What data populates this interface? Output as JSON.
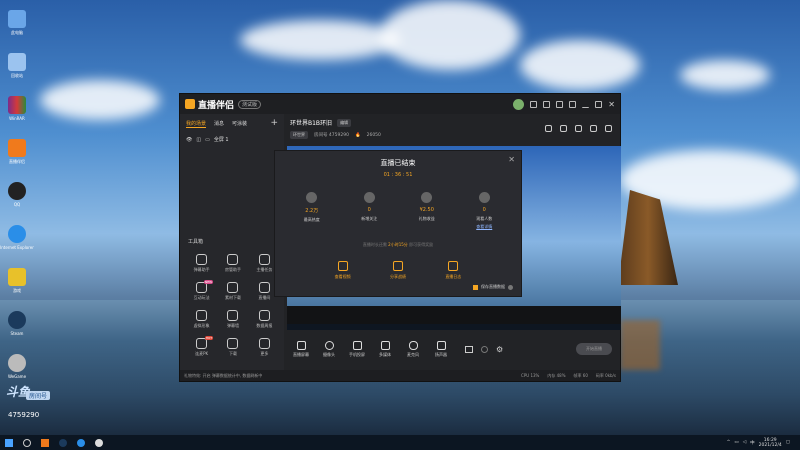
{
  "desktop": {
    "icons": [
      {
        "name": "pc-icon",
        "label": "此电脑"
      },
      {
        "name": "recycle-bin-icon",
        "label": "回收站"
      },
      {
        "name": "winrar-icon",
        "label": "WinRAR"
      },
      {
        "name": "app-orange-icon",
        "label": "直播伴侣"
      },
      {
        "name": "qq-icon",
        "label": "QQ"
      },
      {
        "name": "ie-icon",
        "label": "Internet Explorer"
      },
      {
        "name": "game-icon",
        "label": "游戏"
      },
      {
        "name": "steam-icon",
        "label": "Steam"
      },
      {
        "name": "wegame-icon",
        "label": "WeGame"
      }
    ],
    "watermark": "斗鱼",
    "room_tag": "房间号",
    "room_id": "4759290"
  },
  "window": {
    "app_title": "直播伴侣",
    "version": "测试版",
    "left_tabs": [
      "我的场景",
      "消息",
      "可涂装"
    ],
    "scene_item": "全屏 1",
    "tools_title": "工具箱",
    "tools": [
      {
        "label": "弹幕助手",
        "icon": "chat-icon",
        "badge": ""
      },
      {
        "label": "房管助手",
        "icon": "user-icon",
        "badge": ""
      },
      {
        "label": "主播任务",
        "icon": "task-icon",
        "badge": ""
      },
      {
        "label": "互动玩法",
        "icon": "game-icon",
        "badge": "NEW"
      },
      {
        "label": "素材下载",
        "icon": "download-icon",
        "badge": ""
      },
      {
        "label": "直播间",
        "icon": "room-icon",
        "badge": ""
      },
      {
        "label": "虚拟形象",
        "icon": "avatar-icon",
        "badge": ""
      },
      {
        "label": "弹幕墙",
        "icon": "calendar-icon",
        "badge": ""
      },
      {
        "label": "数据周报",
        "icon": "report-icon",
        "badge": ""
      },
      {
        "label": "连麦PK",
        "icon": "pk-icon",
        "badge": "HOT"
      },
      {
        "label": "下载",
        "icon": "download-icon",
        "badge": ""
      },
      {
        "label": "更多",
        "icon": "more-icon",
        "badge": ""
      }
    ],
    "stream_title": "环世界B1B环旧",
    "edit_label": "编辑",
    "category": "环世界",
    "room_info": "房间号 4759290",
    "fans": "26050",
    "dialog": {
      "title": "直播已结束",
      "duration": "01 : 36 : 51",
      "stats": [
        {
          "value": "2.2万",
          "label": "最高热度",
          "icon": "fire-icon"
        },
        {
          "value": "0",
          "label": "新增关注",
          "icon": "heart-icon"
        },
        {
          "value": "¥2.50",
          "label": "礼物收益",
          "icon": "gift-icon"
        },
        {
          "value": "0",
          "label": "观看人数",
          "icon": "people-icon",
          "link": "查看详情"
        }
      ],
      "tip_prefix": "直播时长还需",
      "tip_highlight": "2小时15分",
      "tip_suffix": "即可获得奖励",
      "actions": [
        {
          "label": "查看视频",
          "icon": "video-icon"
        },
        {
          "label": "分享战绩",
          "icon": "share-icon"
        },
        {
          "label": "直播日志",
          "icon": "log-icon"
        }
      ],
      "save_label": "保存直播数据"
    },
    "controls": [
      {
        "label": "直播屏幕",
        "icon": "screen-icon"
      },
      {
        "label": "摄像头",
        "icon": "camera-icon"
      },
      {
        "label": "手机投屏",
        "icon": "phone-icon"
      },
      {
        "label": "多媒体",
        "icon": "media-icon"
      },
      {
        "label": "麦克风",
        "icon": "mic-icon"
      },
      {
        "label": "扬声器",
        "icon": "speaker-icon"
      }
    ],
    "start_label": "开始直播",
    "status_left": "礼物特效: 开启  弹幕数据统计中, 数据刷新中",
    "status_right": [
      "CPU 13%",
      "内存 48%",
      "帧率 60",
      "码率 0kb/s"
    ]
  },
  "taskbar": {
    "time": "16:29",
    "date": "2021/12/4"
  }
}
